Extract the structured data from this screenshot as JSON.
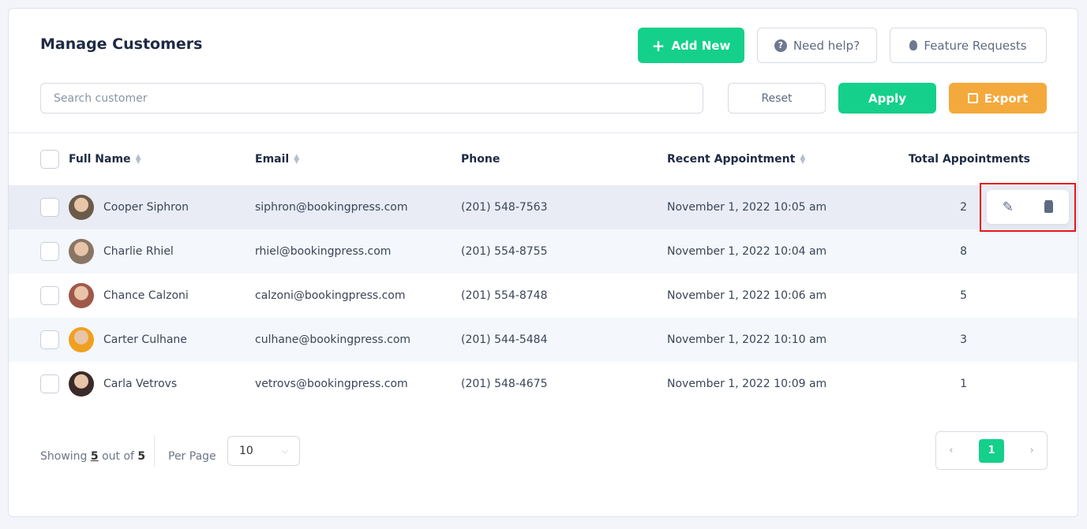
{
  "header": {
    "title": "Manage Customers",
    "add_new": "Add New",
    "need_help": "Need help?",
    "feature_requests": "Feature Requests"
  },
  "filters": {
    "search_placeholder": "Search customer",
    "reset": "Reset",
    "apply": "Apply",
    "export": "Export"
  },
  "columns": [
    "Full Name",
    "Email",
    "Phone",
    "Recent Appointment",
    "Total Appointments"
  ],
  "rows": [
    {
      "name": "Cooper Siphron",
      "email": "siphron@bookingpress.com",
      "phone": "(201) 548-7563",
      "recent": "November 1, 2022 10:05 am",
      "total": "2",
      "avatar_color": "#6b5a4a"
    },
    {
      "name": "Charlie Rhiel",
      "email": "rhiel@bookingpress.com",
      "phone": "(201) 554-8755",
      "recent": "November 1, 2022 10:04 am",
      "total": "8",
      "avatar_color": "#8a7565"
    },
    {
      "name": "Chance Calzoni",
      "email": "calzoni@bookingpress.com",
      "phone": "(201) 554-8748",
      "recent": "November 1, 2022 10:06 am",
      "total": "5",
      "avatar_color": "#a0584a"
    },
    {
      "name": "Carter Culhane",
      "email": "culhane@bookingpress.com",
      "phone": "(201) 544-5484",
      "recent": "November 1, 2022 10:10 am",
      "total": "3",
      "avatar_color": "#f0a020"
    },
    {
      "name": "Carla Vetrovs",
      "email": "vetrovs@bookingpress.com",
      "phone": "(201) 548-4675",
      "recent": "November 1, 2022 10:09 am",
      "total": "1",
      "avatar_color": "#3a2a2a"
    }
  ],
  "footer": {
    "showing": "Showing",
    "shown": "5",
    "out_of": "out of",
    "total": "5",
    "per_page_label": "Per Page",
    "per_page": "10",
    "current_page": "1",
    "prev": "‹",
    "next": "›"
  },
  "colors": {
    "accent": "#14d08a",
    "export": "#f4a93c",
    "highlight": "#e8141b"
  }
}
